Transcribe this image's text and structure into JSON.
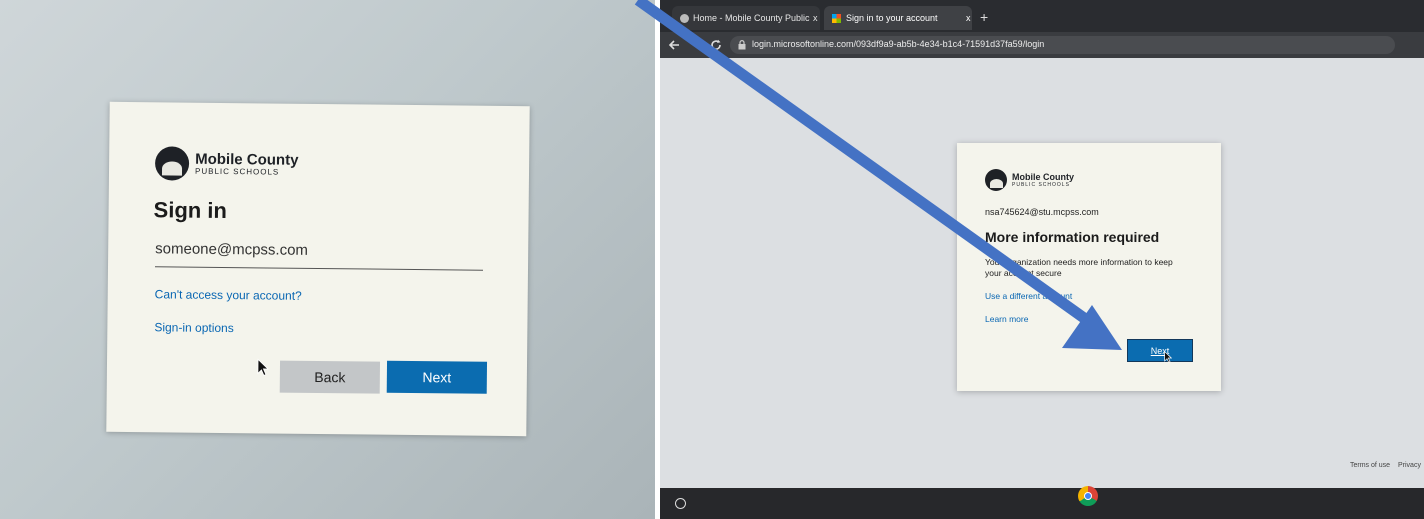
{
  "left_screen": {
    "logo": {
      "name": "Mobile County",
      "subname": "PUBLIC SCHOOLS"
    },
    "heading": "Sign in",
    "email_field": {
      "value": "someone@mcpss.com"
    },
    "cant_access_link": "Can't access your account?",
    "signin_options_link": "Sign-in options",
    "back_button": "Back",
    "next_button": "Next"
  },
  "right_screen": {
    "tabs": [
      {
        "label": "Home - Mobile County Public Sc",
        "close": "x"
      },
      {
        "label": "Sign in to your account",
        "close": "x"
      }
    ],
    "new_tab": "+",
    "url": "login.microsoftonline.com/093df9a9-ab5b-4e34-b1c4-71591d37fa59/login",
    "logo": {
      "name": "Mobile County",
      "subname": "PUBLIC SCHOOLS"
    },
    "account": "nsa745624@stu.mcpss.com",
    "heading": "More information required",
    "message": "Your organization needs more information to keep your account secure",
    "use_different_account": "Use a different account",
    "learn_more": "Learn more",
    "next_button": "Next",
    "footer_links": [
      "Terms of use",
      "Privacy"
    ]
  },
  "colors": {
    "primary_button": "#0b6cb0",
    "link": "#0a67b3",
    "annotation_arrow": "#4472c4"
  },
  "icons": [
    "back-arrow-icon",
    "reload-icon",
    "lock-icon",
    "chrome-icon",
    "launcher-icon",
    "mouse-cursor-icon"
  ]
}
